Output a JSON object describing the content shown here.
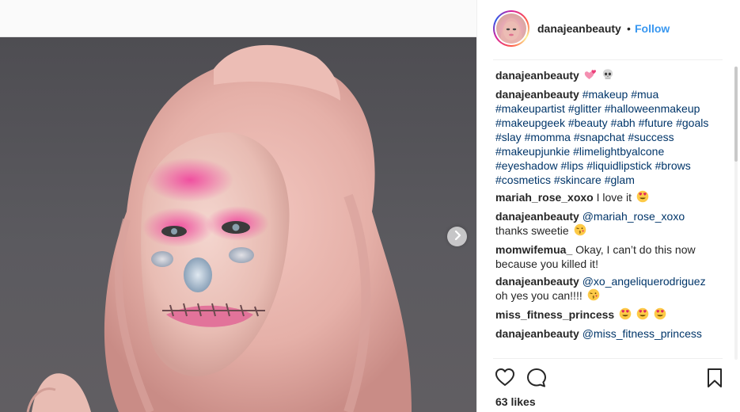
{
  "post": {
    "username": "danajeanbeauty",
    "separator": "•",
    "follow_label": "Follow",
    "likes": "63 likes"
  },
  "comments": [
    {
      "user": "danajeanbeauty",
      "parts": [
        {
          "type": "emoji",
          "name": "two-hearts"
        },
        {
          "type": "emoji",
          "name": "skull"
        }
      ]
    },
    {
      "user": "danajeanbeauty",
      "parts": [
        {
          "type": "tag",
          "text": "#makeup"
        },
        {
          "type": "tag",
          "text": "#mua"
        },
        {
          "type": "tag",
          "text": "#makeupartist"
        },
        {
          "type": "tag",
          "text": "#glitter"
        },
        {
          "type": "tag",
          "text": "#halloweenmakeup"
        },
        {
          "type": "tag",
          "text": "#makeupgeek"
        },
        {
          "type": "tag",
          "text": "#beauty"
        },
        {
          "type": "tag",
          "text": "#abh"
        },
        {
          "type": "tag",
          "text": "#future"
        },
        {
          "type": "tag",
          "text": "#goals"
        },
        {
          "type": "tag",
          "text": "#slay"
        },
        {
          "type": "tag",
          "text": "#momma"
        },
        {
          "type": "tag",
          "text": "#snapchat"
        },
        {
          "type": "tag",
          "text": "#success"
        },
        {
          "type": "tag",
          "text": "#makeupjunkie"
        },
        {
          "type": "tag",
          "text": "#limelightbyalcone"
        },
        {
          "type": "tag",
          "text": "#eyeshadow"
        },
        {
          "type": "tag",
          "text": "#lips"
        },
        {
          "type": "tag",
          "text": "#liquidlipstick"
        },
        {
          "type": "tag",
          "text": "#brows"
        },
        {
          "type": "tag",
          "text": "#cosmetics"
        },
        {
          "type": "tag",
          "text": "#skincare"
        },
        {
          "type": "tag",
          "text": "#glam"
        }
      ]
    },
    {
      "user": "mariah_rose_xoxo",
      "parts": [
        {
          "type": "text",
          "text": "I love it"
        },
        {
          "type": "emoji",
          "name": "heart-eyes"
        }
      ]
    },
    {
      "user": "danajeanbeauty",
      "parts": [
        {
          "type": "mention",
          "text": "@mariah_rose_xoxo"
        },
        {
          "type": "text",
          "text": "thanks sweetie"
        },
        {
          "type": "emoji",
          "name": "kiss-face"
        }
      ]
    },
    {
      "user": "momwifemua_",
      "parts": [
        {
          "type": "text",
          "text": "Okay, I can’t do this now because you killed it!"
        }
      ]
    },
    {
      "user": "danajeanbeauty",
      "parts": [
        {
          "type": "mention",
          "text": "@xo_angeliquerodriguez"
        },
        {
          "type": "text",
          "text": "oh yes you can!!!!"
        },
        {
          "type": "emoji",
          "name": "kiss-face"
        }
      ]
    },
    {
      "user": "miss_fitness_princess",
      "parts": [
        {
          "type": "emoji",
          "name": "heart-eyes"
        },
        {
          "type": "emoji",
          "name": "heart-eyes"
        },
        {
          "type": "emoji",
          "name": "heart-eyes"
        }
      ]
    },
    {
      "user": "danajeanbeauty",
      "parts": [
        {
          "type": "mention",
          "text": "@miss_fitness_princess"
        }
      ]
    }
  ],
  "icons": {
    "like": "heart-outline-icon",
    "comment": "comment-bubble-icon",
    "save": "bookmark-icon",
    "next": "chevron-right-icon"
  },
  "colors": {
    "link": "#003569",
    "follow": "#3897f0",
    "text": "#262626"
  }
}
